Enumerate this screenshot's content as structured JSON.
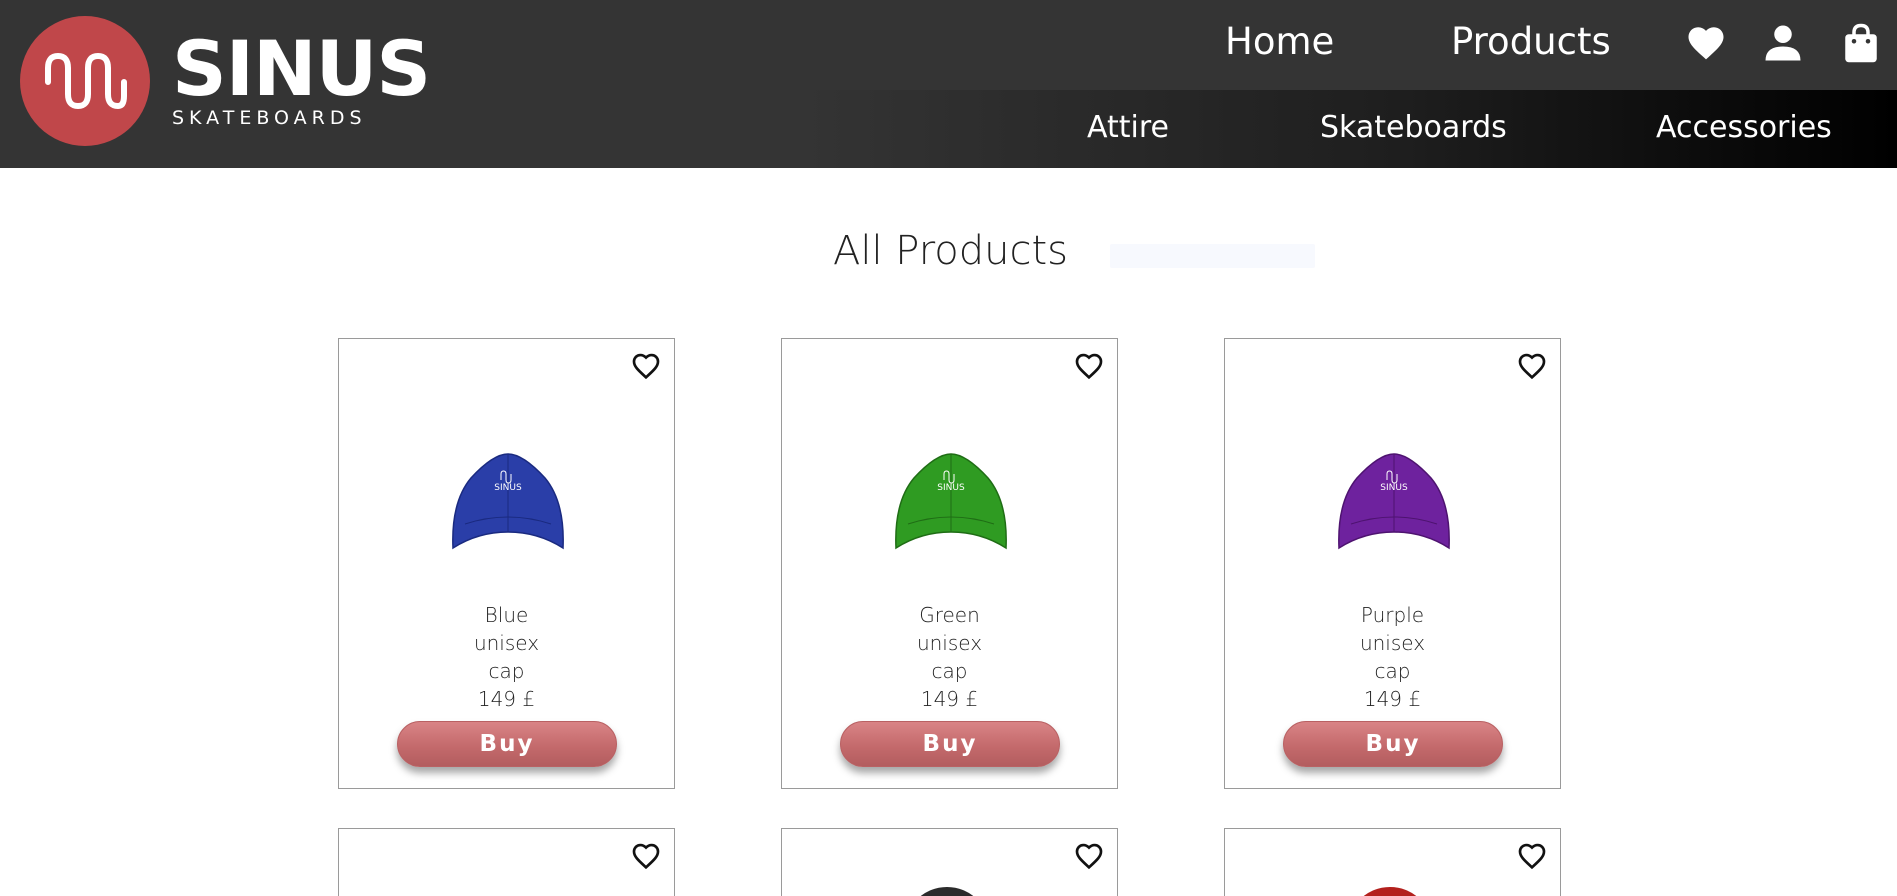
{
  "brand": {
    "name": "SINUS",
    "tagline": "SKATEBOARDS",
    "logo_color": "#c0474a"
  },
  "nav": {
    "main": [
      "Home",
      "Products"
    ],
    "sub": [
      "Attire",
      "Skateboards",
      "Accessories"
    ],
    "icons": [
      "heart-icon",
      "user-icon",
      "shopping-bag-icon"
    ]
  },
  "page": {
    "title": "All Products"
  },
  "products": [
    {
      "name_lines": [
        "Blue",
        "unisex",
        "cap"
      ],
      "price": "149 £",
      "buy_label": "Buy",
      "color": "#2a3ea8"
    },
    {
      "name_lines": [
        "Green",
        "unisex",
        "cap"
      ],
      "price": "149 £",
      "buy_label": "Buy",
      "color": "#2f9b22"
    },
    {
      "name_lines": [
        "Purple",
        "unisex",
        "cap"
      ],
      "price": "149 £",
      "buy_label": "Buy",
      "color": "#6e229e"
    }
  ],
  "partial_products": [
    {
      "color": "#ffffff"
    },
    {
      "color": "#2b2b2b"
    },
    {
      "color": "#b3201d"
    }
  ],
  "colors": {
    "header_bg": "#343434",
    "buy_button": "#c96e70"
  }
}
